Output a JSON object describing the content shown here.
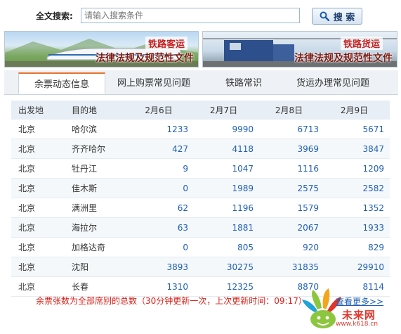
{
  "search": {
    "label": "全文搜索:",
    "placeholder": "请输入搜索条件",
    "button_label": "搜 索"
  },
  "banners": [
    {
      "tag": "铁路客运",
      "title": "法律法规及规范性文件"
    },
    {
      "tag": "铁路货运",
      "title": "法律法规及规范性文件"
    }
  ],
  "tabs": [
    {
      "label": "余票动态信息"
    },
    {
      "label": "网上购票常见问题"
    },
    {
      "label": "铁路常识"
    },
    {
      "label": "货运办理常见问题"
    }
  ],
  "table": {
    "headers": [
      "出发地",
      "目的地",
      "2月6日",
      "2月7日",
      "2月8日",
      "2月9日"
    ],
    "rows": [
      [
        "北京",
        "哈尔滨",
        "1233",
        "9990",
        "6713",
        "5671"
      ],
      [
        "北京",
        "齐齐哈尔",
        "427",
        "4118",
        "3969",
        "3847"
      ],
      [
        "北京",
        "牡丹江",
        "9",
        "1047",
        "1116",
        "1209"
      ],
      [
        "北京",
        "佳木斯",
        "0",
        "1989",
        "2575",
        "2582"
      ],
      [
        "北京",
        "满洲里",
        "62",
        "1196",
        "1579",
        "1352"
      ],
      [
        "北京",
        "海拉尔",
        "63",
        "1881",
        "2067",
        "1933"
      ],
      [
        "北京",
        "加格达奇",
        "0",
        "805",
        "920",
        "829"
      ],
      [
        "北京",
        "沈阳",
        "3893",
        "30275",
        "31835",
        "29910"
      ],
      [
        "北京",
        "长春",
        "1310",
        "12325",
        "8870",
        "8114"
      ]
    ]
  },
  "footer": {
    "note": "余票张数为全部席别的总数（30分钟更新一次，上次更新时间：09:17）",
    "more_link": "查看更多>>"
  },
  "logo": {
    "text": "未来网",
    "url": "www.k618.cn"
  },
  "colors": {
    "accent_blue": "#1f5fb4",
    "note_red": "#d9221a",
    "tab_accent": "#e8742a"
  }
}
